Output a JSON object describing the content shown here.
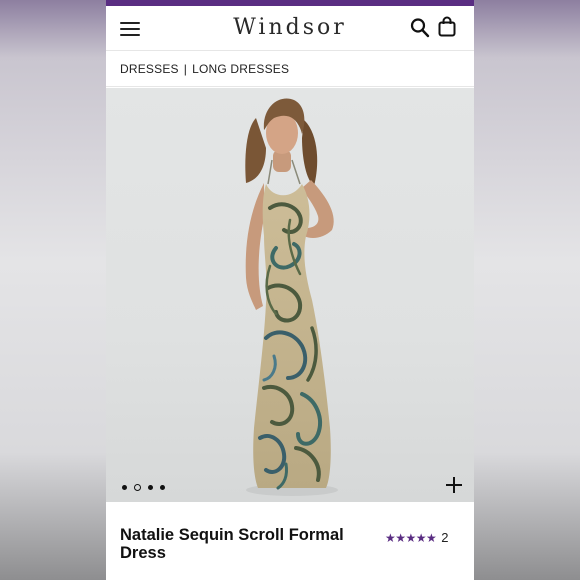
{
  "header": {
    "brand": "WINDSOR",
    "accent_color": "#5a2d82",
    "icons": [
      "menu-icon",
      "search-icon",
      "shopping-bag-icon"
    ]
  },
  "breadcrumb": {
    "items": [
      "DRESSES",
      "LONG DRESSES"
    ],
    "separator": "|"
  },
  "gallery": {
    "image_count": 4,
    "active_index": 1,
    "expand_icon": "plus-icon"
  },
  "product": {
    "name": "Natalie Sequin Scroll Formal Dress",
    "rating_stars": "★★★★★",
    "rating_value": 5,
    "review_count": "2"
  }
}
